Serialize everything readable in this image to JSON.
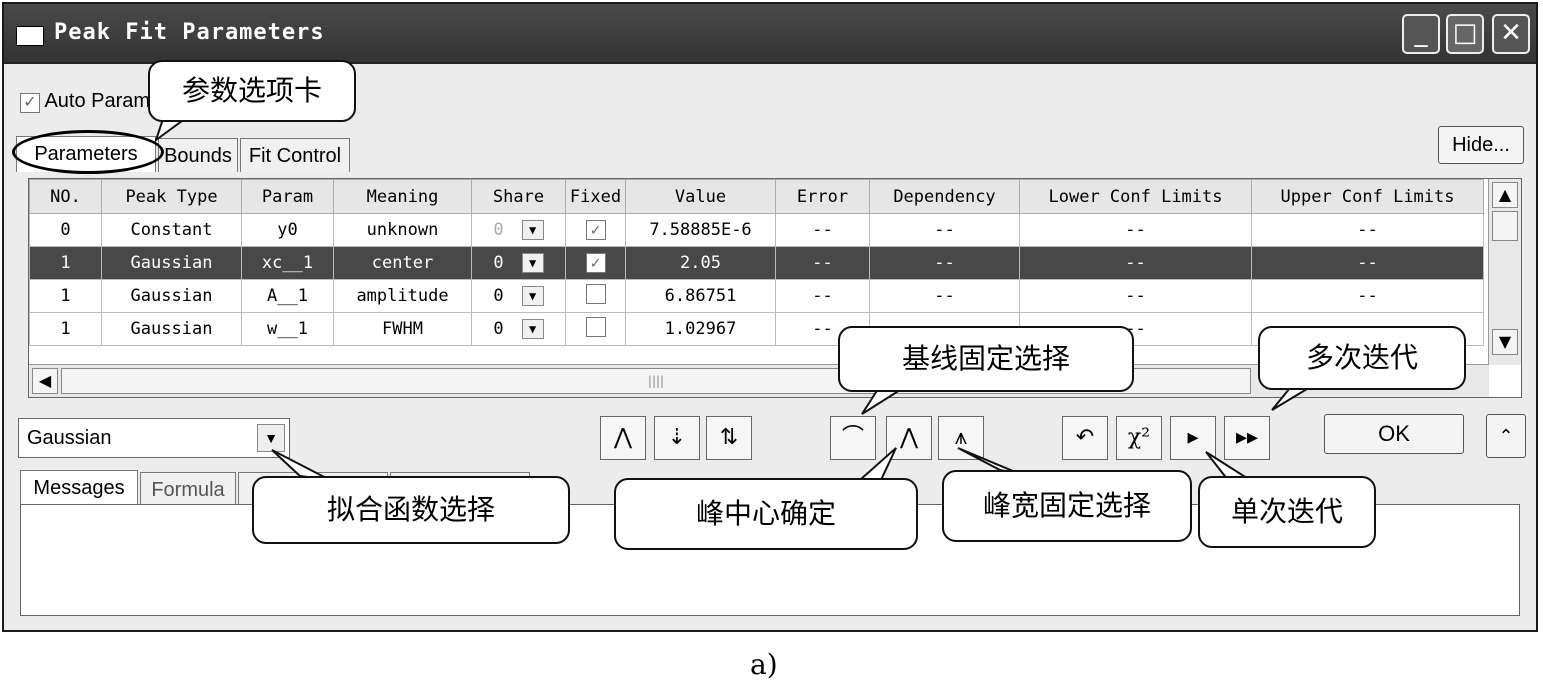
{
  "window": {
    "title": "Peak Fit Parameters",
    "min_icon": "minimize-icon",
    "max_icon": "maximize-icon",
    "close_icon": "close-icon"
  },
  "auto_param": {
    "label": "Auto Param",
    "checked": true
  },
  "tabs": [
    "Parameters",
    "Bounds",
    "Fit Control"
  ],
  "hide_button": "Hide...",
  "table": {
    "headers": [
      "NO.",
      "Peak Type",
      "Param",
      "Meaning",
      "Share",
      "Fixed",
      "Value",
      "Error",
      "Dependency",
      "Lower Conf Limits",
      "Upper Conf Limits"
    ],
    "rows": [
      {
        "no": "0",
        "type": "Constant",
        "param": "y0",
        "meaning": "unknown",
        "share": "0",
        "fixed": true,
        "value": "7.58885E-6",
        "error": "--",
        "dep": "--",
        "lower": "--",
        "upper": "--",
        "selected": false
      },
      {
        "no": "1",
        "type": "Gaussian",
        "param": "xc__1",
        "meaning": "center",
        "share": "0",
        "fixed": true,
        "value": "2.05",
        "error": "--",
        "dep": "--",
        "lower": "--",
        "upper": "--",
        "selected": true
      },
      {
        "no": "1",
        "type": "Gaussian",
        "param": "A__1",
        "meaning": "amplitude",
        "share": "0",
        "fixed": false,
        "value": "6.86751",
        "error": "--",
        "dep": "--",
        "lower": "--",
        "upper": "--",
        "selected": false
      },
      {
        "no": "1",
        "type": "Gaussian",
        "param": "w__1",
        "meaning": "FWHM",
        "share": "0",
        "fixed": false,
        "value": "1.02967",
        "error": "--",
        "dep": "",
        "lower": "--",
        "upper": "",
        "selected": false
      }
    ]
  },
  "function_select": {
    "value": "Gaussian"
  },
  "bottom_tabs": [
    "Messages",
    "Formula"
  ],
  "ok_button": "OK",
  "callouts": {
    "param_tab": "参数选项卡",
    "baseline": "基线固定选择",
    "multi_iter": "多次迭代",
    "fit_func": "拟合函数选择",
    "peak_center": "峰中心确定",
    "peak_width": "峰宽固定选择",
    "single_iter": "单次迭代"
  },
  "caption": "a)"
}
